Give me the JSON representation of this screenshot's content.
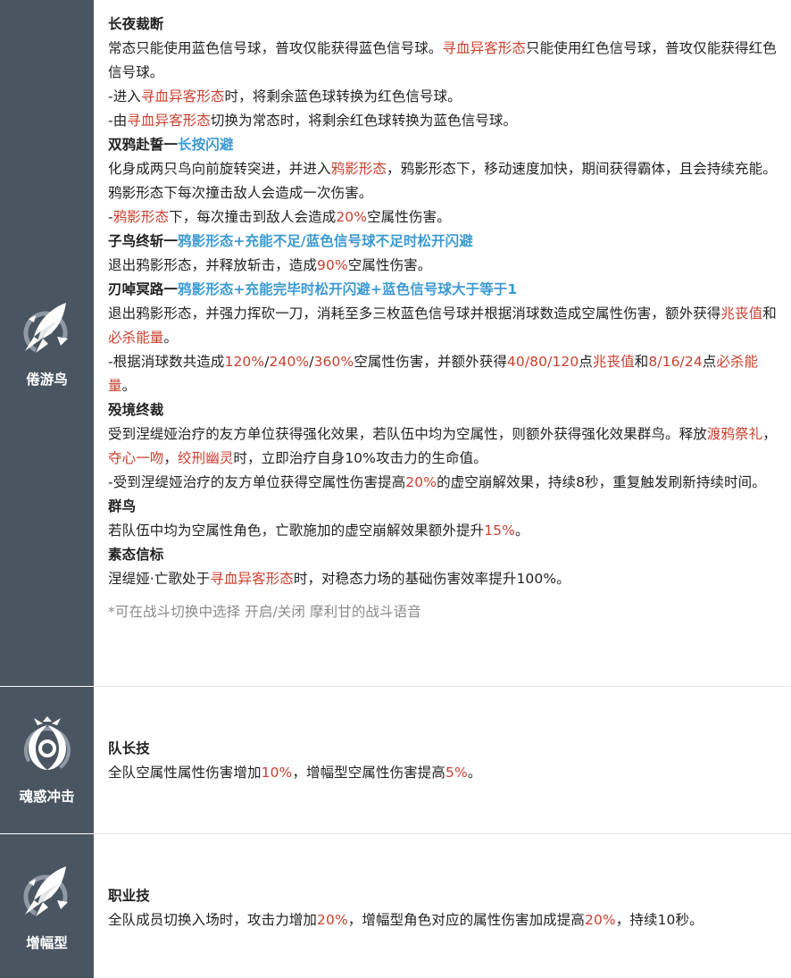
{
  "rows": [
    {
      "side_label": "倦游鸟",
      "side_icon": "feather-bird-icon",
      "lines": [
        [
          {
            "t": "长夜裁断",
            "s": "h"
          }
        ],
        [
          {
            "t": "常态只能使用蓝色信号球，普攻仅能获得蓝色信号球。"
          },
          {
            "t": "寻血异客形态",
            "s": "r"
          },
          {
            "t": "只能使用红色信号球，普攻仅能获得红色信号球。"
          }
        ],
        [
          {
            "t": "-进入"
          },
          {
            "t": "寻血异客形态",
            "s": "r"
          },
          {
            "t": "时，将剩余蓝色球转换为红色信号球。"
          }
        ],
        [
          {
            "t": "-由"
          },
          {
            "t": "寻血异客形态",
            "s": "r"
          },
          {
            "t": "切换为常态时，将剩余红色球转换为蓝色信号球。"
          }
        ],
        [
          {
            "t": "双鸦赴誓一",
            "s": "h"
          },
          {
            "t": "长按闪避",
            "s": "b"
          }
        ],
        [
          {
            "t": "化身成两只鸟向前旋转突进，并进入"
          },
          {
            "t": "鸦影形态",
            "s": "r"
          },
          {
            "t": "，鸦影形态下，移动速度加快，期间获得霸体，且会持续充能。鸦影形态下每次撞击敌人会造成一次伤害。"
          }
        ],
        [
          {
            "t": "-"
          },
          {
            "t": "鸦影形态",
            "s": "r"
          },
          {
            "t": "下，每次撞击到敌人会造成"
          },
          {
            "t": "20%",
            "s": "r"
          },
          {
            "t": "空属性伤害。"
          }
        ],
        [
          {
            "t": "子鸟终斩一",
            "s": "h"
          },
          {
            "t": "鸦影形态+充能不足/蓝色信号球不足时松开闪避",
            "s": "b"
          }
        ],
        [
          {
            "t": "退出鸦影形态，并释放斩击，造成"
          },
          {
            "t": "90%",
            "s": "r"
          },
          {
            "t": "空属性伤害。"
          }
        ],
        [
          {
            "t": "刃啅冥路一",
            "s": "h"
          },
          {
            "t": "鸦影形态+充能完毕时松开闪避+蓝色信号球大于等于1",
            "s": "b"
          }
        ],
        [
          {
            "t": "退出鸦影形态，并强力挥砍一刀，消耗至多三枚蓝色信号球并根据消球数造成空属性伤害，额外获得"
          },
          {
            "t": "兆丧值",
            "s": "r"
          },
          {
            "t": "和"
          },
          {
            "t": "必杀能量",
            "s": "r"
          },
          {
            "t": "。"
          }
        ],
        [
          {
            "t": "-根据消球数共造成"
          },
          {
            "t": "120%",
            "s": "r"
          },
          {
            "t": "/"
          },
          {
            "t": "240%",
            "s": "r"
          },
          {
            "t": "/"
          },
          {
            "t": "360%",
            "s": "r"
          },
          {
            "t": "空属性伤害，并额外获得"
          },
          {
            "t": "40/80/120",
            "s": "r"
          },
          {
            "t": "点"
          },
          {
            "t": "兆丧值",
            "s": "r"
          },
          {
            "t": "和"
          },
          {
            "t": "8/16/24",
            "s": "r"
          },
          {
            "t": "点"
          },
          {
            "t": "必杀能量",
            "s": "r"
          },
          {
            "t": "。"
          }
        ],
        [
          {
            "t": "殁境终裁",
            "s": "h"
          }
        ],
        [
          {
            "t": "受到涅缇娅治疗的友方单位获得强化效果，若队伍中均为空属性，则额外获得强化效果群鸟。释放"
          },
          {
            "t": "渡鸦祭礼",
            "s": "r"
          },
          {
            "t": "，"
          },
          {
            "t": "夺心一吻",
            "s": "r"
          },
          {
            "t": "，"
          },
          {
            "t": "绞刑幽灵",
            "s": "r"
          },
          {
            "t": "时，立即治疗自身10%攻击力的生命值。"
          }
        ],
        [
          {
            "t": "-受到涅缇娅治疗的友方单位获得空属性伤害提高"
          },
          {
            "t": "20%",
            "s": "r"
          },
          {
            "t": "的虚空崩解效果，持续8秒，重复触发刷新持续时间。"
          }
        ],
        [
          {
            "t": "群鸟",
            "s": "h"
          }
        ],
        [
          {
            "t": "若队伍中均为空属性角色，亡歌施加的虚空崩解效果额外提升"
          },
          {
            "t": "15%",
            "s": "r"
          },
          {
            "t": "。"
          }
        ],
        [
          {
            "t": "素态信标",
            "s": "h"
          }
        ],
        [
          {
            "t": "涅缇娅·亡歌处于"
          },
          {
            "t": "寻血异客形态",
            "s": "r"
          },
          {
            "t": "时，对稳态力场的基础伤害效率提升100%。"
          }
        ]
      ],
      "note": "*可在战斗切换中选择 开启/关闭 摩利甘的战斗语音"
    },
    {
      "side_label": "魂惑冲击",
      "side_icon": "crescent-ring-icon",
      "lines": [
        [
          {
            "t": "队长技",
            "s": "h"
          }
        ],
        [
          {
            "t": "全队空属性属性伤害增加"
          },
          {
            "t": "10%",
            "s": "r"
          },
          {
            "t": "，增幅型空属性伤害提高"
          },
          {
            "t": "5%",
            "s": "r"
          },
          {
            "t": "。"
          }
        ]
      ]
    },
    {
      "side_label": "增幅型",
      "side_icon": "feather-bird-icon",
      "lines": [
        [
          {
            "t": "职业技",
            "s": "h"
          }
        ],
        [
          {
            "t": "全队成员切换入场时，攻击力增加"
          },
          {
            "t": "20%",
            "s": "r"
          },
          {
            "t": "，增幅型角色对应的属性伤害加成提高"
          },
          {
            "t": "20%",
            "s": "r"
          },
          {
            "t": "，持续10秒。"
          }
        ]
      ]
    }
  ],
  "colors": {
    "sidebar": "#4a5562",
    "highlight_red": "#c9402f",
    "highlight_blue": "#3c9ad2",
    "note_gray": "#8a8a8a"
  }
}
